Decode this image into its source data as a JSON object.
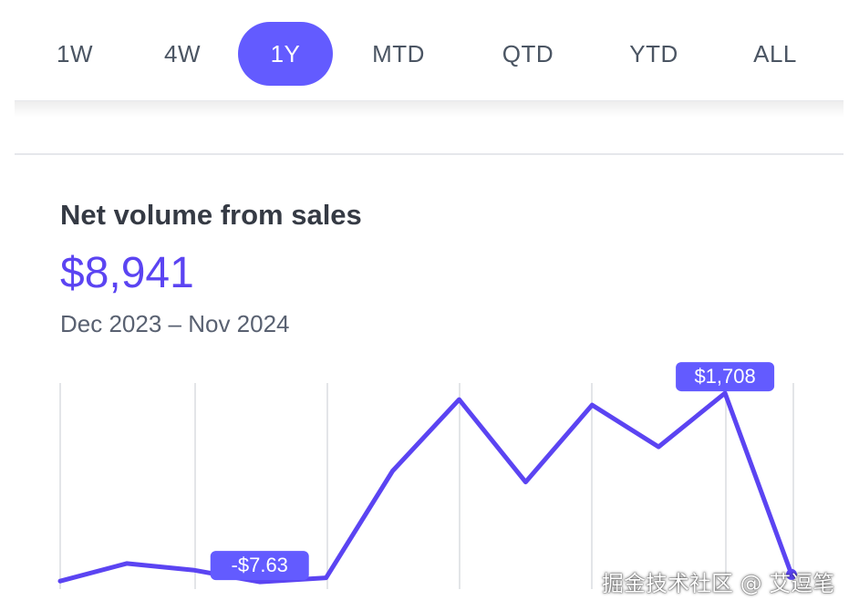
{
  "tabs": [
    {
      "label": "1W",
      "active": false
    },
    {
      "label": "4W",
      "active": false
    },
    {
      "label": "1Y",
      "active": true
    },
    {
      "label": "MTD",
      "active": false
    },
    {
      "label": "QTD",
      "active": false
    },
    {
      "label": "YTD",
      "active": false
    },
    {
      "label": "ALL",
      "active": false
    }
  ],
  "card": {
    "title": "Net volume from sales",
    "value": "$8,941",
    "range": "Dec 2023 – Nov 2024"
  },
  "colors": {
    "accent": "#635bff",
    "line": "#5b44f2",
    "grid": "#e3e5e8",
    "title": "#353a44",
    "muted": "#596171"
  },
  "chart_data": {
    "type": "line",
    "series": [
      {
        "values": [
          0,
          160,
          100,
          -7.63,
          30,
          1000,
          1650,
          900,
          1600,
          1220,
          1708,
          60
        ]
      }
    ],
    "ylim": [
      -40,
      1750
    ],
    "grid": true,
    "annotations": [
      {
        "index": 3,
        "label": "-$7.63"
      },
      {
        "index": 10,
        "label": "$1,708"
      }
    ]
  },
  "watermark": "掘金技术社区 @ 艾逗笔"
}
